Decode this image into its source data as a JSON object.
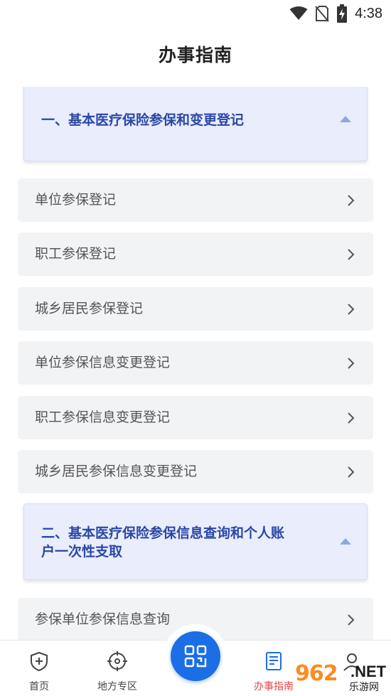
{
  "status_bar": {
    "time": "4:38"
  },
  "page": {
    "title": "办事指南"
  },
  "sections": [
    {
      "title_lines": [
        "一、基本医疗保险参保和变更登记"
      ],
      "items": [
        "单位参保登记",
        "职工参保登记",
        "城乡居民参保登记",
        "单位参保信息变更登记",
        "职工参保信息变更登记",
        "城乡居民参保信息变更登记"
      ]
    },
    {
      "title_lines": [
        "二、基本医疗保险参保信息查询和个人账",
        "户一次性支取"
      ],
      "items": [
        "参保单位参保信息查询"
      ]
    }
  ],
  "tab_bar": {
    "active_color": "#e14545",
    "scan_color": "#1b6ee6",
    "tabs": [
      {
        "label": "首页",
        "icon": "shield-plus-icon"
      },
      {
        "label": "地方专区",
        "icon": "crosshair-icon"
      },
      {
        "label": "",
        "icon": "qr-scan-icon"
      },
      {
        "label": "办事指南",
        "icon": "document-icon",
        "active": true
      },
      {
        "label": "",
        "icon": "user-icon"
      }
    ]
  },
  "watermark": {
    "big": "962",
    "net": ".NET",
    "sub": "乐游网"
  }
}
